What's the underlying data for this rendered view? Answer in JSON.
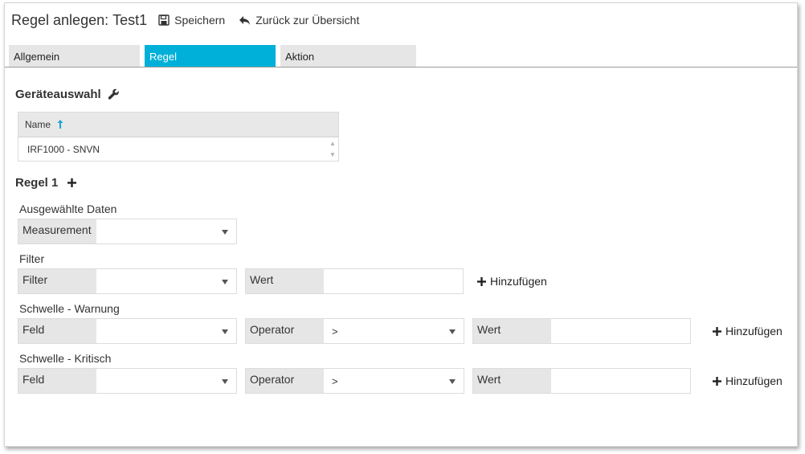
{
  "header": {
    "title_prefix": "Regel anlegen:",
    "rule_name": "Test1",
    "save_label": "Speichern",
    "back_label": "Zurück zur Übersicht"
  },
  "tabs": [
    {
      "label": "Allgemein",
      "active": false
    },
    {
      "label": "Regel",
      "active": true
    },
    {
      "label": "Aktion",
      "active": false
    }
  ],
  "colors": {
    "accent": "#00b0d8",
    "label_bg": "#e6e6e6"
  },
  "device_section": {
    "title": "Geräteauswahl",
    "icon": "wrench-icon",
    "grid": {
      "column_header": "Name",
      "sort": "ascending",
      "rows": [
        "IRF1000 - SNVN"
      ]
    }
  },
  "rule": {
    "title": "Regel 1",
    "add_icon": "plus-icon",
    "selected_data": {
      "label": "Ausgewählte Daten",
      "field_label": "Measurement",
      "value": ""
    },
    "filter": {
      "label": "Filter",
      "field_label": "Filter",
      "field_value": "",
      "value_label": "Wert",
      "value": "",
      "add_label": "Hinzufügen"
    },
    "threshold_warning": {
      "label": "Schwelle - Warnung",
      "field_label": "Feld",
      "field_value": "",
      "operator_label": "Operator",
      "operator_value": ">",
      "value_label": "Wert",
      "value": "",
      "add_label": "Hinzufügen"
    },
    "threshold_critical": {
      "label": "Schwelle - Kritisch",
      "field_label": "Feld",
      "field_value": "",
      "operator_label": "Operator",
      "operator_value": ">",
      "value_label": "Wert",
      "value": "",
      "add_label": "Hinzufügen"
    }
  }
}
